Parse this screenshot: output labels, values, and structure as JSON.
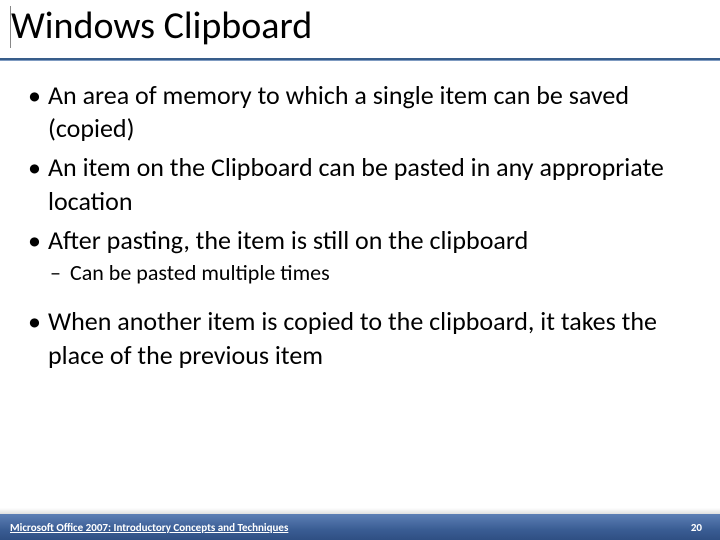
{
  "title": "Windows Clipboard",
  "bullets": {
    "b1": "An area of memory to which a single item can be saved (copied)",
    "b2": "An item on the Clipboard can be pasted in any appropriate location",
    "b3": "After pasting, the item is still on the clipboard",
    "b3_sub1": "Can be pasted multiple times",
    "b4": "When another item is copied to the clipboard, it takes the place of the previous item"
  },
  "footer": {
    "left": "Microsoft Office 2007: Introductory Concepts and Techniques",
    "page": "20"
  }
}
